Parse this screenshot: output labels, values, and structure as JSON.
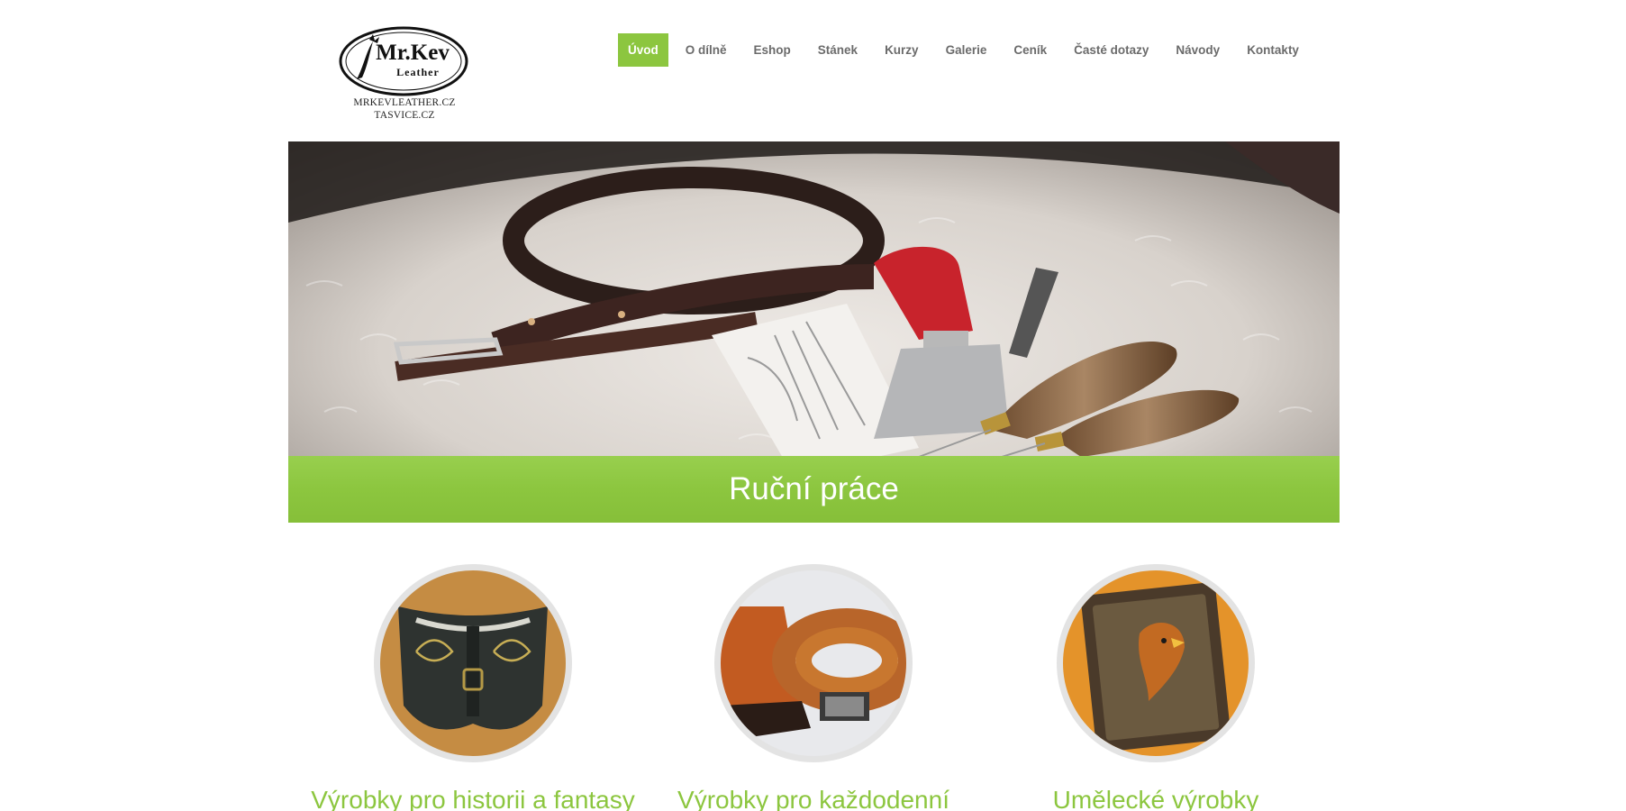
{
  "logo": {
    "brand_line1": "Mr.Kev",
    "brand_line2": "Leather",
    "domain1": "MRKEVLEATHER.CZ",
    "domain2": "TASVICE.CZ"
  },
  "nav": {
    "items": [
      {
        "label": "Úvod",
        "active": true
      },
      {
        "label": "O dílně"
      },
      {
        "label": "Eshop"
      },
      {
        "label": "Stánek"
      },
      {
        "label": "Kurzy"
      },
      {
        "label": "Galerie"
      },
      {
        "label": "Ceník"
      },
      {
        "label": "Časté dotazy"
      },
      {
        "label": "Návody"
      },
      {
        "label": "Kontakty"
      }
    ]
  },
  "hero": {
    "caption": "Ruční práce"
  },
  "features": [
    {
      "title": "Výrobky pro historii a fantasy"
    },
    {
      "title": "Výrobky pro každodenní"
    },
    {
      "title": "Umělecké výrobky"
    }
  ],
  "colors": {
    "accent": "#8cc63f",
    "nav_text": "#6b6b6b"
  }
}
